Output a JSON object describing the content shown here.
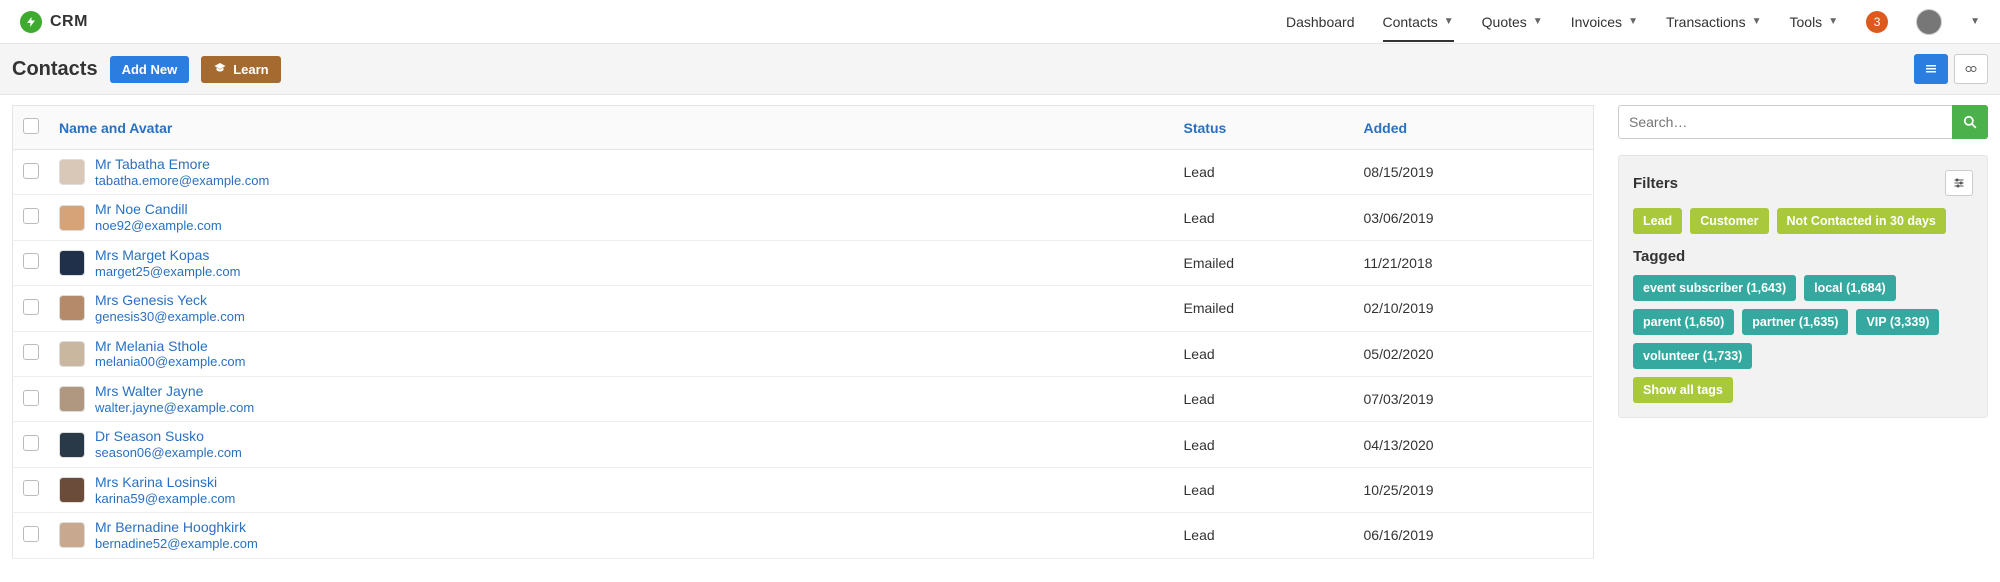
{
  "brand": {
    "name": "CRM"
  },
  "nav": {
    "items": [
      {
        "label": "Dashboard",
        "dropdown": false,
        "active": false
      },
      {
        "label": "Contacts",
        "dropdown": true,
        "active": true
      },
      {
        "label": "Quotes",
        "dropdown": true,
        "active": false
      },
      {
        "label": "Invoices",
        "dropdown": true,
        "active": false
      },
      {
        "label": "Transactions",
        "dropdown": true,
        "active": false
      },
      {
        "label": "Tools",
        "dropdown": true,
        "active": false
      }
    ],
    "notif_count": "3"
  },
  "page": {
    "title": "Contacts",
    "add_label": "Add New",
    "learn_label": "Learn"
  },
  "table": {
    "columns": {
      "name": "Name and Avatar",
      "status": "Status",
      "added": "Added"
    },
    "rows": [
      {
        "name": "Mr Tabatha Emore",
        "email": "tabatha.emore@example.com",
        "status": "Lead",
        "added": "08/15/2019",
        "avatar": "#d9c7b8"
      },
      {
        "name": "Mr Noe Candill",
        "email": "noe92@example.com",
        "status": "Lead",
        "added": "03/06/2019",
        "avatar": "#d5a377"
      },
      {
        "name": "Mrs Marget Kopas",
        "email": "marget25@example.com",
        "status": "Emailed",
        "added": "11/21/2018",
        "avatar": "#20304a"
      },
      {
        "name": "Mrs Genesis Yeck",
        "email": "genesis30@example.com",
        "status": "Emailed",
        "added": "02/10/2019",
        "avatar": "#b48a6b"
      },
      {
        "name": "Mr Melania Sthole",
        "email": "melania00@example.com",
        "status": "Lead",
        "added": "05/02/2020",
        "avatar": "#c9b79f"
      },
      {
        "name": "Mrs Walter Jayne",
        "email": "walter.jayne@example.com",
        "status": "Lead",
        "added": "07/03/2019",
        "avatar": "#b09880"
      },
      {
        "name": "Dr Season Susko",
        "email": "season06@example.com",
        "status": "Lead",
        "added": "04/13/2020",
        "avatar": "#2a3948"
      },
      {
        "name": "Mrs Karina Losinski",
        "email": "karina59@example.com",
        "status": "Lead",
        "added": "10/25/2019",
        "avatar": "#6b4c3a"
      },
      {
        "name": "Mr Bernadine Hooghkirk",
        "email": "bernadine52@example.com",
        "status": "Lead",
        "added": "06/16/2019",
        "avatar": "#c8a98f"
      }
    ]
  },
  "sidebar": {
    "search_placeholder": "Search…",
    "filters_title": "Filters",
    "filters": [
      {
        "label": "Lead"
      },
      {
        "label": "Customer"
      },
      {
        "label": "Not Contacted in 30 days"
      }
    ],
    "tagged_title": "Tagged",
    "tags": [
      {
        "label": "event subscriber (1,643)"
      },
      {
        "label": "local (1,684)"
      },
      {
        "label": "parent (1,650)"
      },
      {
        "label": "partner (1,635)"
      },
      {
        "label": "VIP (3,339)"
      },
      {
        "label": "volunteer (1,733)"
      }
    ],
    "show_all_label": "Show all tags"
  }
}
